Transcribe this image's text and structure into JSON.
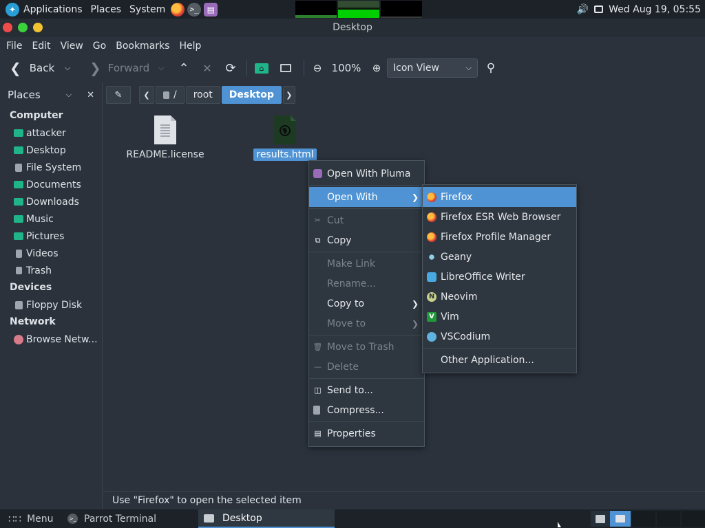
{
  "top_panel": {
    "menus": [
      "Applications",
      "Places",
      "System"
    ],
    "datetime": "Wed Aug 19, 05:55"
  },
  "window": {
    "title": "Desktop",
    "menubar": [
      "File",
      "Edit",
      "View",
      "Go",
      "Bookmarks",
      "Help"
    ]
  },
  "toolbar": {
    "back_label": "Back",
    "forward_label": "Forward",
    "zoom_level": "100%",
    "view_mode": "Icon View"
  },
  "sidebar": {
    "title": "Places",
    "sections": [
      {
        "label": "Computer",
        "items": [
          "attacker",
          "Desktop",
          "File System",
          "Documents",
          "Downloads",
          "Music",
          "Pictures",
          "Videos",
          "Trash"
        ]
      },
      {
        "label": "Devices",
        "items": [
          "Floppy Disk"
        ]
      },
      {
        "label": "Network",
        "items": [
          "Browse Netw..."
        ]
      }
    ]
  },
  "pathbar": {
    "crumbs": [
      "/",
      "root",
      "Desktop"
    ]
  },
  "files": [
    {
      "name": "README.license"
    },
    {
      "name": "results.html"
    }
  ],
  "context_menu": {
    "items": [
      "Open With Pluma",
      "Open With",
      "Cut",
      "Copy",
      "Make Link",
      "Rename...",
      "Copy to",
      "Move to",
      "Move to Trash",
      "Delete",
      "Send to...",
      "Compress...",
      "Properties"
    ]
  },
  "submenu": {
    "items": [
      "Firefox",
      "Firefox ESR Web Browser",
      "Firefox Profile Manager",
      "Geany",
      "LibreOffice Writer",
      "Neovim",
      "Vim",
      "VSCodium",
      "Other Application..."
    ]
  },
  "statusbar": {
    "text": "Use \"Firefox\" to open the selected item"
  },
  "taskbar": {
    "menu_label": "Menu",
    "tasks": [
      "Parrot Terminal",
      "Desktop"
    ]
  }
}
